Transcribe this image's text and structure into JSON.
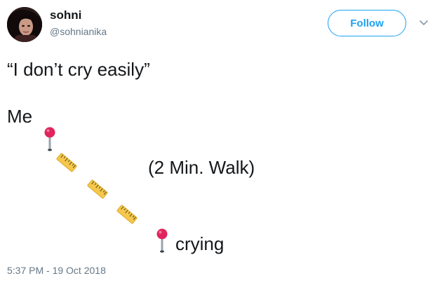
{
  "author": {
    "display_name": "sohni",
    "handle": "@sohnianika"
  },
  "header": {
    "follow_label": "Follow",
    "menu_icon": "chevron-down-icon"
  },
  "tweet": {
    "line1": "“I don’t cry easily”",
    "line2": "Me",
    "walk_label": "(2 Min. Walk)",
    "destination_label": "crying"
  },
  "icons": {
    "pin": "round-pushpin-icon",
    "ruler": "straight-ruler-icon"
  },
  "colors": {
    "accent": "#1da1f2",
    "pin_head": "#e0245e",
    "ruler": "#f5c84c"
  },
  "footer": {
    "timestamp": "5:37 PM - 19 Oct 2018"
  }
}
